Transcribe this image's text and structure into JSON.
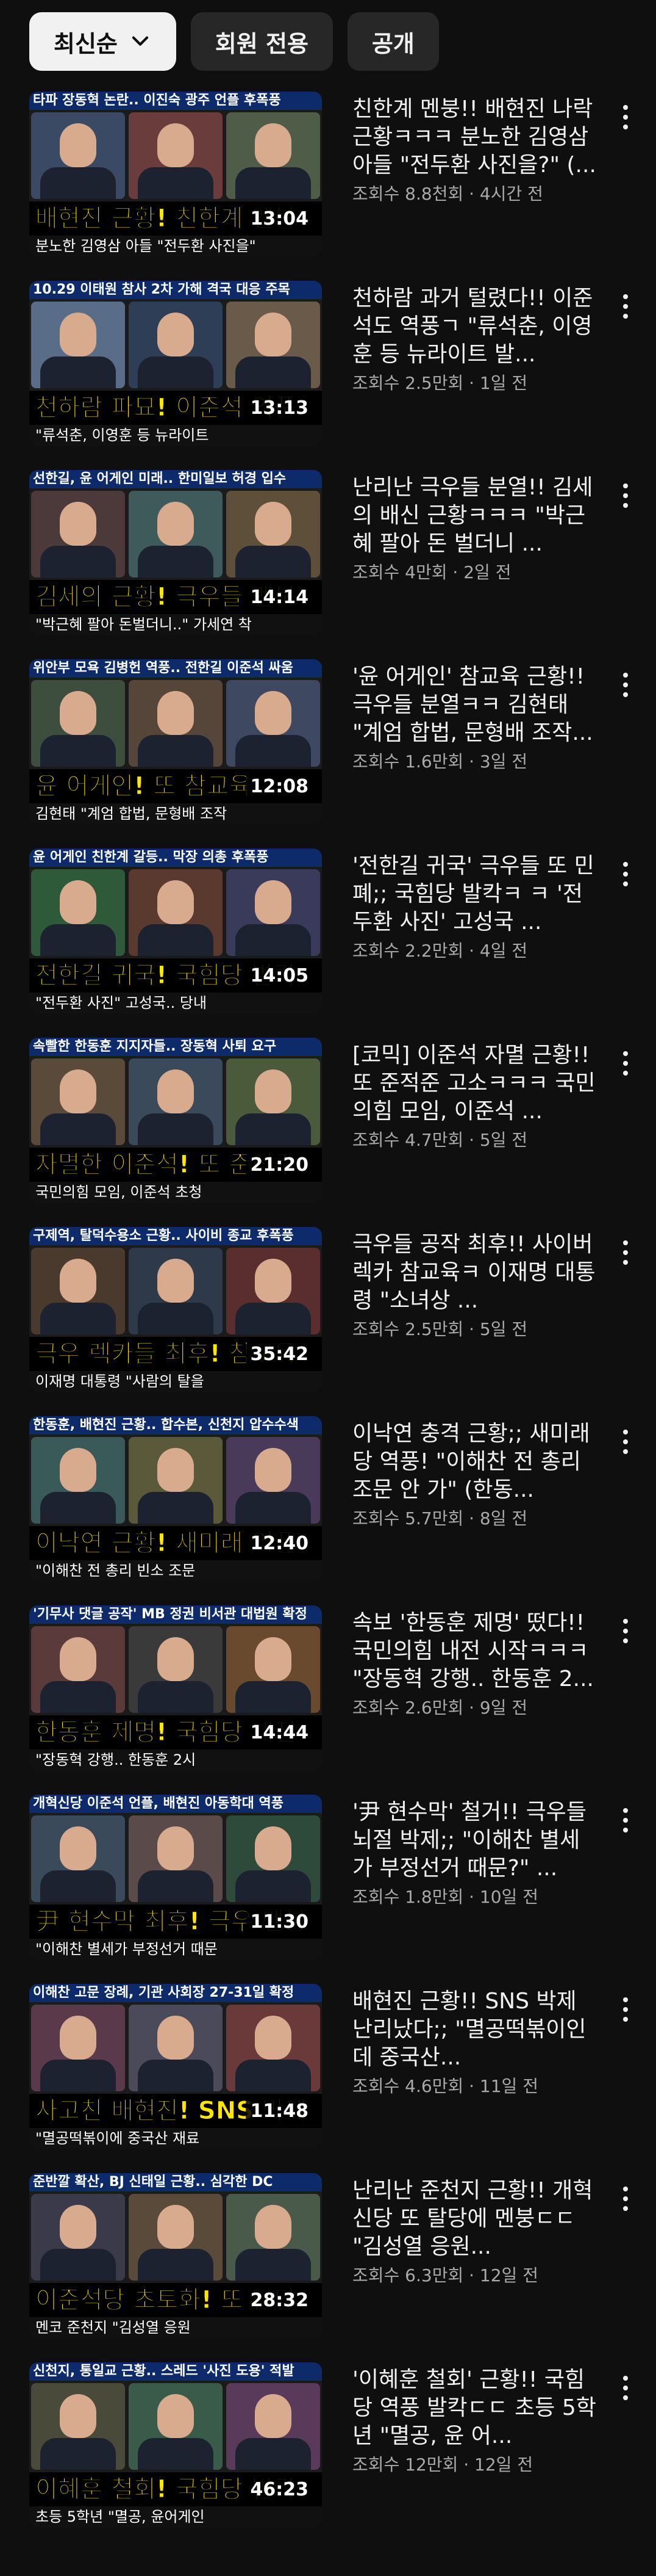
{
  "filters": [
    {
      "label": "최신순",
      "active": true,
      "has_dropdown": true
    },
    {
      "label": "회원 전용",
      "active": false
    },
    {
      "label": "공개",
      "active": false
    }
  ],
  "videos": [
    {
      "thumb_top": "타파 장동혁 논란.. 이진숙 광주 언플 후폭풍",
      "thumb_caption": "배현진 근황! 친한계 멘붕",
      "thumb_sub": "분노한 김영삼 아들 \"전두환 사진을\"",
      "duration": "13:04",
      "title": "친한계 멘붕!! 배현진 나락 근황ㅋㅋㅋ 분노한 김영삼 아들 \"전두환 사진을?\" (...",
      "meta": "조회수 8.8천회 · 4시간 전"
    },
    {
      "thumb_top": "10.29 이태원 참사 2차 가해 격국 대응 주목",
      "thumb_caption": "천하람 파묘! 이준석 역풍",
      "thumb_sub": "\"류석춘, 이영훈 등 뉴라이트",
      "duration": "13:13",
      "title": "천하람 과거 털렸다!! 이준석도 역풍ㄱ \"류석춘, 이영훈 등 뉴라이트 발...",
      "meta": "조회수 2.5만회 · 1일 전"
    },
    {
      "thumb_top": "선한길, 윤 어게인 미래.. 한미일보 허경 입수",
      "thumb_caption": "김세의 근황! 극우들 멘붕",
      "thumb_sub": "\"박근혜 팔아 돈벌더니..\" 가세연 착",
      "duration": "14:14",
      "title": "난리난 극우들 분열!! 김세의 배신 근황ㅋㅋㅋ \"박근혜 팔아 돈 벌더니 ...",
      "meta": "조회수 4만회 · 2일 전"
    },
    {
      "thumb_top": "위안부 모욕 김병헌 역풍.. 전한길 이준석 싸움",
      "thumb_caption": "윤 어게인! 또 참교육",
      "thumb_sub": "김현태 \"계엄 합법, 문형배 조작",
      "duration": "12:08",
      "title": "'윤 어게인' 참교육 근황!! 극우들 분열ㅋㅋ 김현태 \"계엄 합법, 문형배 조작...",
      "meta": "조회수 1.6만회 · 3일 전"
    },
    {
      "thumb_top": "윤 어게인 친한계 갈등.. 막장 의총 후폭풍",
      "thumb_caption": "전한길 귀국! 국힘당 발칵",
      "thumb_sub": "\"전두환 사진\" 고성국.. 당내",
      "duration": "14:05",
      "title": "'전한길 귀국' 극우들 또 민폐;; 국힘당 발칵ㅋ ㅋ '전두환 사진' 고성국 ...",
      "meta": "조회수 2.2만회 · 4일 전"
    },
    {
      "thumb_top": "속빨한 한동훈 지지자들.. 장동혁 사퇴 요구",
      "thumb_caption": "자멸한 이준석! 또 준적주",
      "thumb_sub": "국민의힘 모임, 이준석 초청",
      "duration": "21:20",
      "title": "[코믹] 이준석 자멸 근황!! 또 준적준 고소ㅋㅋㅋ 국민의힘 모임, 이준석 ...",
      "meta": "조회수 4.7만회 · 5일 전"
    },
    {
      "thumb_top": "구제역, 탈덕수용소 근황.. 사이비 종교 후폭풍",
      "thumb_caption": "극우 렉카들 최후! 참교육",
      "thumb_sub": "이재명 대통령 \"사람의 탈을",
      "duration": "35:42",
      "title": "극우들 공작 최후!! 사이버 렉카 참교육ㅋ 이재명 대통령 \"소녀상 ...",
      "meta": "조회수 2.5만회 · 5일 전"
    },
    {
      "thumb_top": "한동훈, 배현진 근황.. 합수본, 신천지 압수수색",
      "thumb_caption": "이낙연 근황! 새미래 역풍",
      "thumb_sub": "\"이해찬 전 총리 빈소 조문",
      "duration": "12:40",
      "title": "이낙연 충격 근황;; 새미래당 역풍! \"이해찬 전 총리 조문 안 가\" (한동...",
      "meta": "조회수 5.7만회 · 8일 전"
    },
    {
      "thumb_top": "'기무사 댓글 공작' MB 정권 비서관 대법원 확정",
      "thumb_caption": "한동훈 제명! 국힘당 내전",
      "thumb_sub": "\"장동혁 강행.. 한동훈 2시",
      "duration": "14:44",
      "title": "속보 '한동훈 제명' 떴다!! 국민의힘 내전 시작ㅋㅋㅋ \"장동혁 강행.. 한동훈 2...",
      "meta": "조회수 2.6만회 · 9일 전"
    },
    {
      "thumb_top": "개혁신당 이준석 언플, 배현진 아동학대 역풍",
      "thumb_caption": "尹 현수막 최후! 극우 멘붕",
      "thumb_sub": "\"이해찬 별세가 부정선거 때문",
      "duration": "11:30",
      "title": "'尹 현수막' 철거!! 극우들 뇌절 박제;; \"이해찬 별세가 부정선거 때문?\" ...",
      "meta": "조회수 1.8만회 · 10일 전"
    },
    {
      "thumb_top": "이해찬 고문 장례, 기관 사회장 27-31일 확정",
      "thumb_caption": "사고친 배현진! SNS 박제",
      "thumb_sub": "\"멸공떡볶이에 중국산 재료",
      "duration": "11:48",
      "title": "배현진 근황!! SNS 박제 난리났다;; \"멸공떡볶이인데 중국산...",
      "meta": "조회수 4.6만회 · 11일 전"
    },
    {
      "thumb_top": "준반깔 확산, BJ 신태일 근황.. 심각한 DC",
      "thumb_caption": "이준석당 초토화! 또 탈당",
      "thumb_sub": "멘코 준천지 \"김성열 응원",
      "duration": "28:32",
      "title": "난리난 준천지 근황!! 개혁신당 또 탈당에 멘붕ㄷㄷ \"김성열 응원...",
      "meta": "조회수 6.3만회 · 12일 전"
    },
    {
      "thumb_top": "신천지, 통일교 근황.. 스레드 '사진 도용' 적발",
      "thumb_caption": "이혜훈 철회! 국힘당 발칵",
      "thumb_sub": "초등 5학년 \"멸공, 윤어게인",
      "duration": "46:23",
      "title": "'이혜훈 철회' 근황!! 국힘당 역풍 발칵ㄷㄷ 초등 5학년 \"멸공, 윤 어...",
      "meta": "조회수 12만회 · 12일 전"
    }
  ],
  "colors": {
    "background": "#0f0f0f",
    "chip": "#272727",
    "chip_active": "#f1f1f1",
    "caption": "#ffe600",
    "meta": "#aaaaaa"
  },
  "icons": {
    "dropdown": "chevron-down-icon",
    "more": "more-vert-icon"
  }
}
